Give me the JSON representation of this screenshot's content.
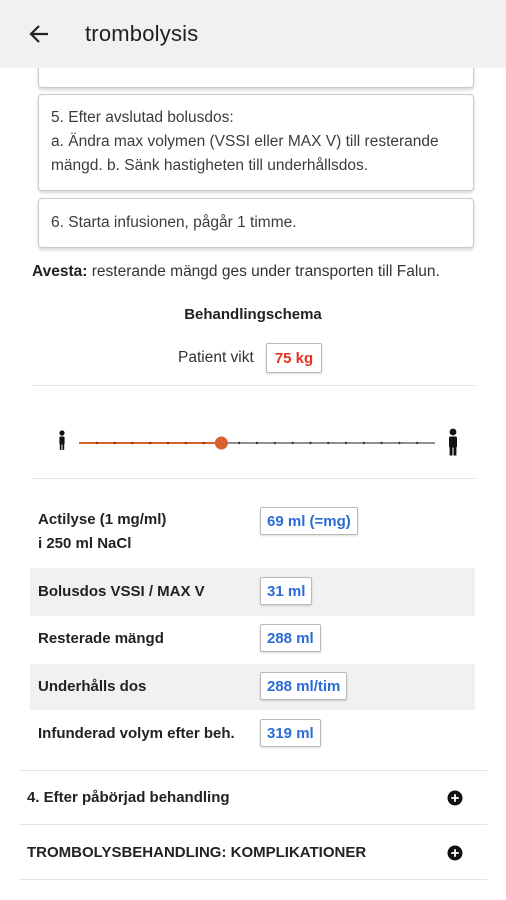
{
  "header": {
    "title": "trombolysis"
  },
  "steps": {
    "step5": {
      "line1": "5. Efter avslutad bolusdos:",
      "line2": "a. Ändra max volymen (VSSI eller MAX V) till resterande",
      "line3": "mängd. b. Sänk hastigheten till underhållsdos."
    },
    "step6": "6. Starta infusionen, pågår 1 timme."
  },
  "avesta": {
    "label": "Avesta:",
    "text": " resterande mängd ges under transporten till Falun."
  },
  "schema": {
    "title": "Behandlingschema",
    "weight_label": "Patient vikt",
    "weight_value": "75 kg",
    "slider_fraction": 0.4
  },
  "results": [
    {
      "label_line1": "Actilyse (1 mg/ml)",
      "label_line2": "i 250 ml NaCl",
      "value": "69 ml (=mg)"
    },
    {
      "label": "Bolusdos VSSI / MAX V",
      "value": "31 ml"
    },
    {
      "label": "Resterade mängd",
      "value": "288 ml"
    },
    {
      "label": "Underhålls dos",
      "value": "288 ml/tim"
    },
    {
      "label": "Infunderad volym efter beh.",
      "value": "319 ml"
    }
  ],
  "sections": [
    {
      "label": "4. Efter påbörjad behandling",
      "icon": "plus-circle-icon"
    },
    {
      "label": "TROMBOLYSBEHANDLING: KOMPLIKATIONER",
      "icon": "plus-circle-icon"
    }
  ],
  "colors": {
    "slider_active": "#d9602f",
    "weight_value": "#e53323",
    "result_value": "#2b6bd4"
  }
}
